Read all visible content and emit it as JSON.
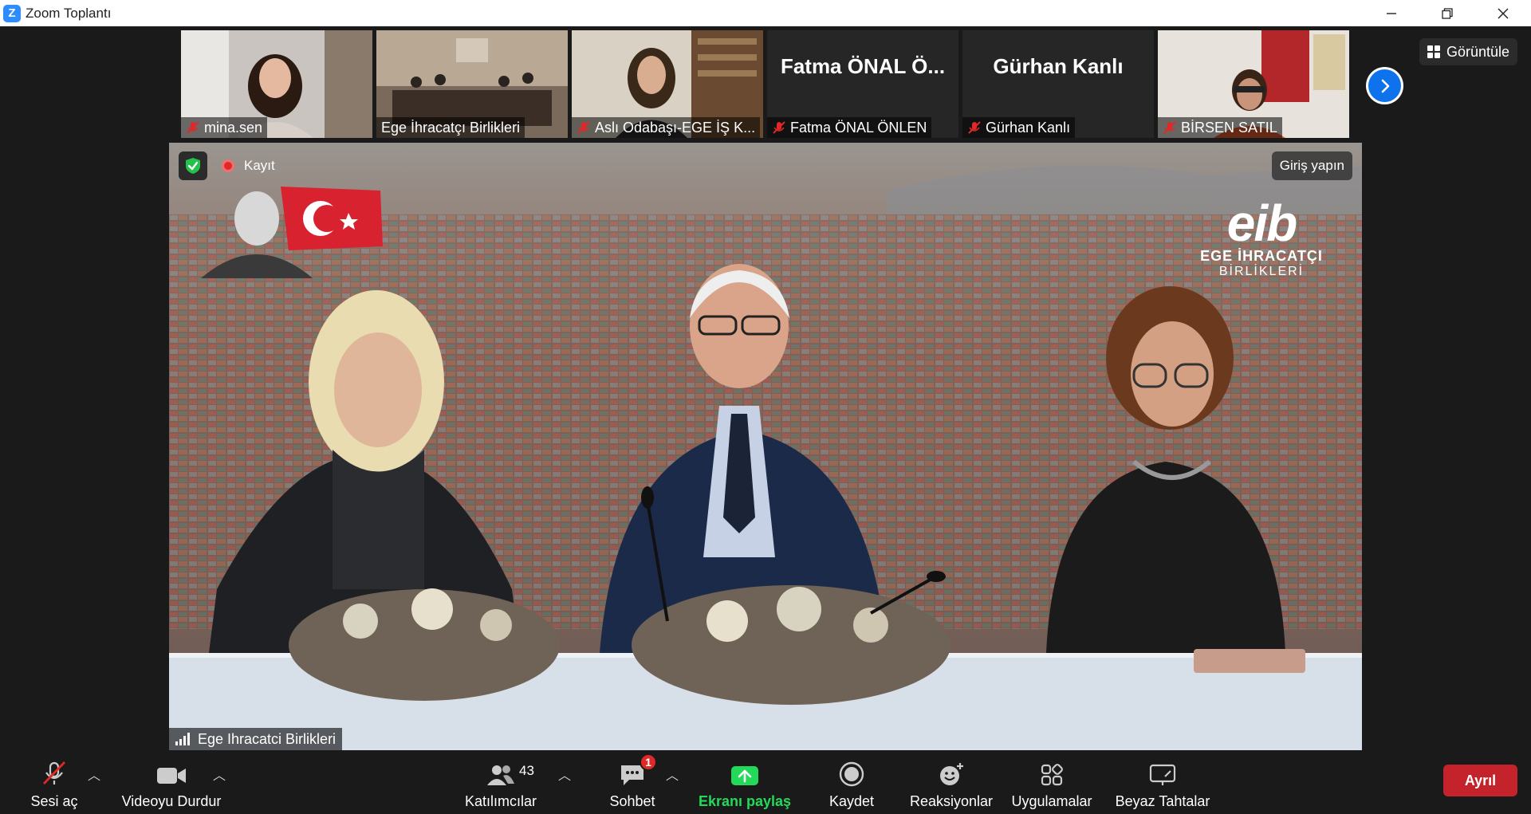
{
  "window": {
    "title": "Zoom Toplantı",
    "logo_letter": "Z"
  },
  "gallery": {
    "participants": [
      {
        "name": "mina.sen",
        "muted": true,
        "video": true
      },
      {
        "name": "Ege İhracatçı Birlikleri",
        "muted": false,
        "video": true
      },
      {
        "name": "Aslı Odabaşı-EGE İŞ K...",
        "muted": true,
        "video": true
      },
      {
        "name": "Fatma ÖNAL ÖNLEN",
        "display_name": "Fatma ÖNAL Ö...",
        "muted": true,
        "video": false
      },
      {
        "name": "Gürhan Kanlı",
        "display_name": "Gürhan Kanlı",
        "muted": true,
        "video": false
      },
      {
        "name": "BİRSEN SATIL",
        "muted": true,
        "video": true
      }
    ],
    "view_label": "Görüntüle"
  },
  "main_video": {
    "recording_label": "Kayıt",
    "sign_in_label": "Giriş yapın",
    "speaker_name": "Ege Ihracatci Birlikleri",
    "logo": {
      "big": "eib",
      "line1": "EGE İHRACATÇI",
      "line2": "BİRLİKLERİ"
    }
  },
  "toolbar": {
    "unmute_label": "Sesi aç",
    "stop_video_label": "Videoyu Durdur",
    "participants_label": "Katılımcılar",
    "participants_count": "43",
    "chat_label": "Sohbet",
    "chat_badge": "1",
    "share_label": "Ekranı paylaş",
    "record_label": "Kaydet",
    "reactions_label": "Reaksiyonlar",
    "apps_label": "Uygulamalar",
    "whiteboard_label": "Beyaz Tahtalar",
    "leave_label": "Ayrıl"
  },
  "colors": {
    "accent_blue": "#0e72ed",
    "share_green": "#23d959",
    "leave_red": "#c4232b",
    "muted_red": "#e02828"
  }
}
